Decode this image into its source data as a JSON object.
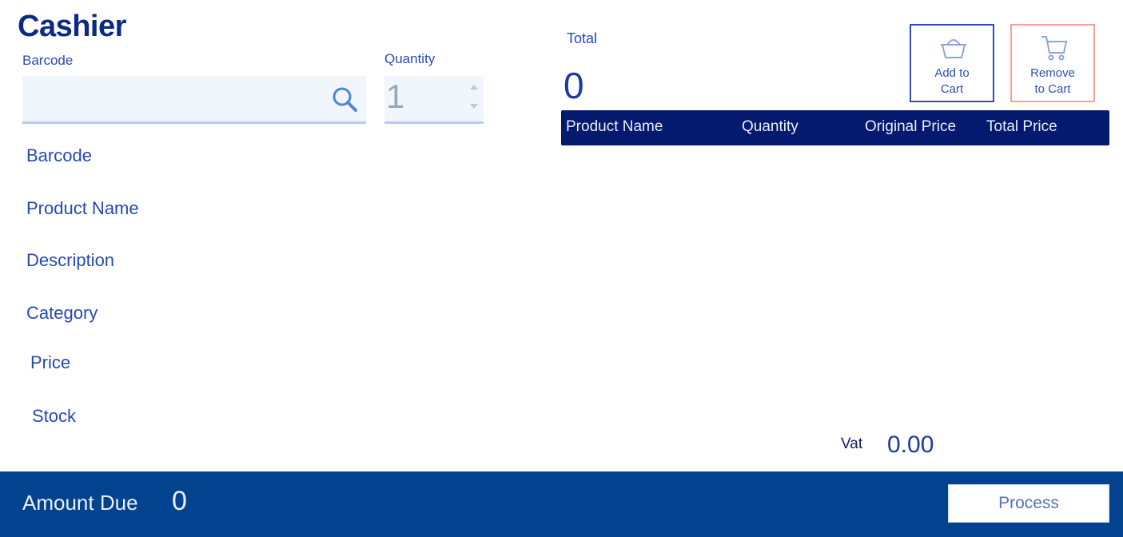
{
  "app": {
    "title": "Cashier"
  },
  "search": {
    "barcode_label": "Barcode",
    "barcode_value": "",
    "quantity_label": "Quantity",
    "quantity_value": "1"
  },
  "details": {
    "labels": [
      "Barcode",
      "Product Name",
      "Description",
      "Category",
      "Price",
      "Stock"
    ]
  },
  "cart": {
    "total_label": "Total",
    "total_value": "0",
    "add_button": {
      "line1": "Add to",
      "line2": "Cart",
      "icon": "basket-icon"
    },
    "remove_button": {
      "line1": "Remove",
      "line2": "to Cart",
      "icon": "cart-icon"
    },
    "columns": [
      "Product Name",
      "Quantity",
      "Original Price",
      "Total Price"
    ],
    "rows": []
  },
  "vat": {
    "label": "Vat",
    "value": "0.00"
  },
  "footer": {
    "amount_due_label": "Amount Due",
    "amount_due_value": "0",
    "process_label": "Process"
  },
  "colors": {
    "title": "#0b2a86",
    "table_header": "#041a6e",
    "footer": "#03428e",
    "add_border": "#2e4fb5",
    "remove_border": "#f4a398"
  }
}
